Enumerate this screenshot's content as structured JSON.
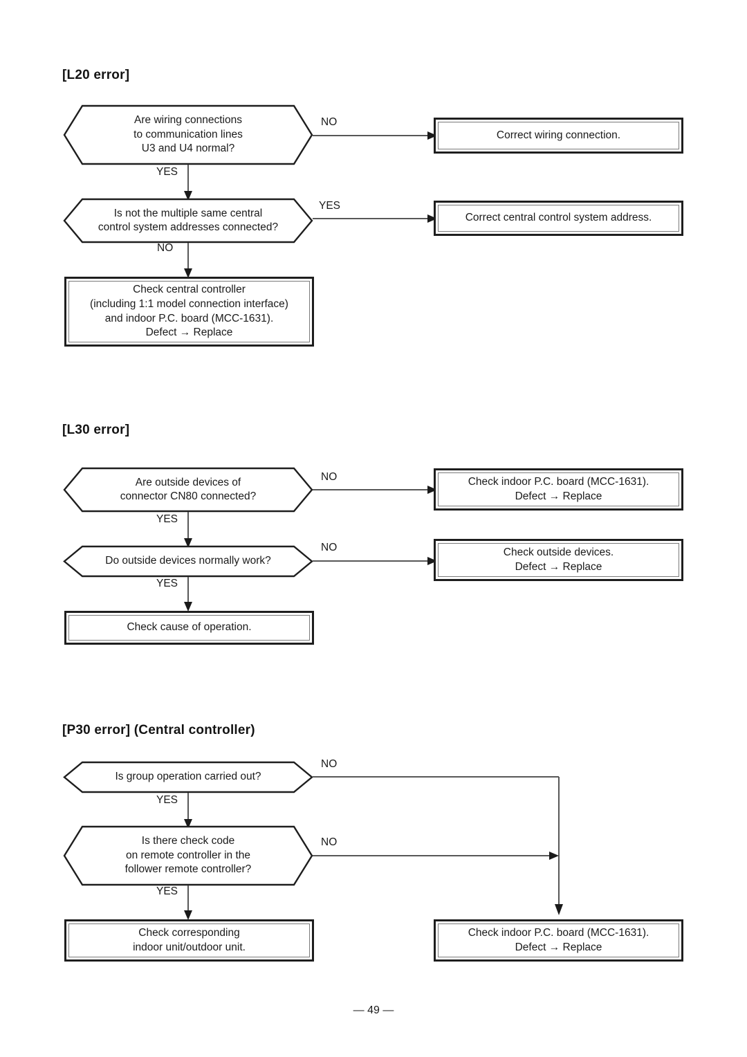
{
  "page": {
    "footer": "— 49 —"
  },
  "sections": [
    {
      "heading": "[L20 error]",
      "decisions": [
        {
          "text": "Are wiring connections\nto communication lines\nU3 and U4 normal?",
          "branch_out_label": "NO",
          "branch_down_label": "YES"
        },
        {
          "text": "Is not the multiple same central\ncontrol system addresses connected?",
          "branch_out_label": "YES",
          "branch_down_label": "NO"
        }
      ],
      "results": [
        {
          "text": "Correct wiring connection."
        },
        {
          "text": "Correct central control system address."
        },
        {
          "text": "Check central controller\n(including 1:1 model connection interface)\nand indoor P.C. board (MCC-1631).\nDefect → Replace"
        }
      ]
    },
    {
      "heading": "[L30 error]",
      "decisions": [
        {
          "text": "Are outside devices of\nconnector CN80 connected?",
          "branch_out_label": "NO",
          "branch_down_label": "YES"
        },
        {
          "text": "Do outside devices normally work?",
          "branch_out_label": "NO",
          "branch_down_label": "YES"
        }
      ],
      "results": [
        {
          "text": "Check indoor P.C. board (MCC-1631).\nDefect → Replace"
        },
        {
          "text": "Check outside devices.\nDefect → Replace"
        },
        {
          "text": "Check cause of operation."
        }
      ]
    },
    {
      "heading": "[P30 error] (Central controller)",
      "decisions": [
        {
          "text": "Is group operation carried out?",
          "branch_out_label": "NO",
          "branch_down_label": "YES"
        },
        {
          "text": "Is there check code\non remote controller in the\nfollower remote controller?",
          "branch_out_label": "NO",
          "branch_down_label": "YES"
        }
      ],
      "results": [
        {
          "text": "Check corresponding\nindoor unit/outdoor unit."
        },
        {
          "text": "Check indoor P.C. board (MCC-1631).\nDefect → Replace"
        }
      ]
    }
  ]
}
